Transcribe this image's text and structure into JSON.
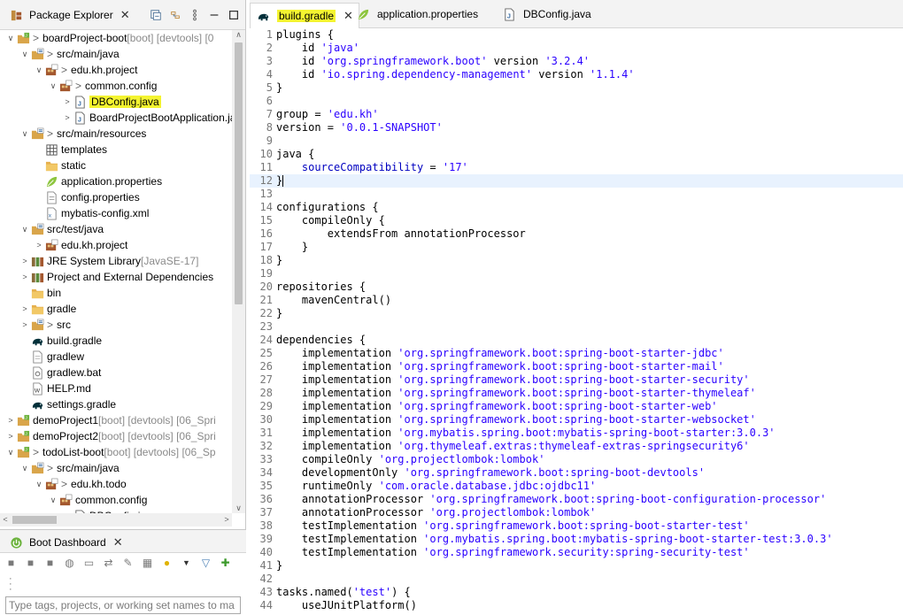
{
  "explorer": {
    "tab_label": "Package Explorer",
    "rows": [
      {
        "tw": "∨",
        "icon": "project-icon",
        "gt": ">",
        "label": "boardProject-boot",
        "dec": " [boot] [devtools] [0",
        "hl": false
      },
      {
        "tw": "∨",
        "icon": "source-folder-icon",
        "gt": ">",
        "label": "src/main/java",
        "dec": "",
        "hl": false
      },
      {
        "tw": "∨",
        "icon": "package-icon",
        "gt": ">",
        "label": "edu.kh.project",
        "dec": "",
        "hl": false
      },
      {
        "tw": "∨",
        "icon": "package-icon",
        "gt": ">",
        "label": "common.config",
        "dec": "",
        "hl": false
      },
      {
        "tw": ">",
        "icon": "java-file-icon",
        "gt": "",
        "label": "DBConfig.java",
        "dec": "",
        "hl": true
      },
      {
        "tw": ">",
        "icon": "java-file-icon",
        "gt": "",
        "label": "BoardProjectBootApplication.jav",
        "dec": "",
        "hl": false
      },
      {
        "tw": "∨",
        "icon": "source-folder-icon",
        "gt": ">",
        "label": "src/main/resources",
        "dec": "",
        "hl": false
      },
      {
        "tw": "",
        "icon": "grid-folder-icon",
        "gt": "",
        "label": "templates",
        "dec": "",
        "hl": false
      },
      {
        "tw": "",
        "icon": "folder-icon",
        "gt": "",
        "label": "static",
        "dec": "",
        "hl": false
      },
      {
        "tw": "",
        "icon": "spring-leaf-icon",
        "gt": "",
        "label": "application.properties",
        "dec": "",
        "hl": false
      },
      {
        "tw": "",
        "icon": "properties-file-icon",
        "gt": "",
        "label": "config.properties",
        "dec": "",
        "hl": false
      },
      {
        "tw": "",
        "icon": "xml-file-icon",
        "gt": "",
        "label": "mybatis-config.xml",
        "dec": "",
        "hl": false
      },
      {
        "tw": "∨",
        "icon": "source-folder-icon",
        "gt": "",
        "label": "src/test/java",
        "dec": "",
        "hl": false
      },
      {
        "tw": ">",
        "icon": "package-icon",
        "gt": "",
        "label": "edu.kh.project",
        "dec": "",
        "hl": false
      },
      {
        "tw": ">",
        "icon": "library-icon",
        "gt": "",
        "label": "JRE System Library",
        "dec": " [JavaSE-17]",
        "hl": false
      },
      {
        "tw": ">",
        "icon": "library-icon",
        "gt": "",
        "label": "Project and External Dependencies",
        "dec": "",
        "hl": false
      },
      {
        "tw": "",
        "icon": "folder-icon",
        "gt": "",
        "label": "bin",
        "dec": "",
        "hl": false
      },
      {
        "tw": ">",
        "icon": "folder-icon",
        "gt": "",
        "label": "gradle",
        "dec": "",
        "hl": false
      },
      {
        "tw": ">",
        "icon": "source-folder-icon",
        "gt": ">",
        "label": "src",
        "dec": "",
        "hl": false
      },
      {
        "tw": "",
        "icon": "gradle-elephant-icon",
        "gt": "",
        "label": "build.gradle",
        "dec": "",
        "hl": false
      },
      {
        "tw": "",
        "icon": "text-file-icon",
        "gt": "",
        "label": "gradlew",
        "dec": "",
        "hl": false
      },
      {
        "tw": "",
        "icon": "bat-file-icon",
        "gt": "",
        "label": "gradlew.bat",
        "dec": "",
        "hl": false
      },
      {
        "tw": "",
        "icon": "markdown-file-icon",
        "gt": "",
        "label": "HELP.md",
        "dec": "",
        "hl": false
      },
      {
        "tw": "",
        "icon": "gradle-elephant-icon",
        "gt": "",
        "label": "settings.gradle",
        "dec": "",
        "hl": false
      },
      {
        "tw": ">",
        "icon": "project-icon",
        "gt": "",
        "label": "demoProject1",
        "dec": " [boot] [devtools] [06_Spri",
        "hl": false
      },
      {
        "tw": ">",
        "icon": "project-icon",
        "gt": "",
        "label": "demoProject2",
        "dec": " [boot] [devtools] [06_Spri",
        "hl": false
      },
      {
        "tw": "∨",
        "icon": "project-icon",
        "gt": ">",
        "label": "todoList-boot",
        "dec": " [boot] [devtools] [06_Sp",
        "hl": false
      },
      {
        "tw": "∨",
        "icon": "source-folder-icon",
        "gt": ">",
        "label": "src/main/java",
        "dec": "",
        "hl": false
      },
      {
        "tw": "∨",
        "icon": "package-icon",
        "gt": ">",
        "label": "edu.kh.todo",
        "dec": "",
        "hl": false
      },
      {
        "tw": "∨",
        "icon": "package-icon",
        "gt": "",
        "label": "common.config",
        "dec": "",
        "hl": false
      },
      {
        "tw": "",
        "icon": "java-file-icon",
        "gt": "",
        "label": "DBConfig.java",
        "dec": "",
        "hl": false
      }
    ]
  },
  "boot_dashboard": {
    "tab_label": "Boot Dashboard",
    "filter_placeholder": "Type tags, projects, or working set names to ma"
  },
  "editor": {
    "tabs": [
      {
        "label": "build.gradle",
        "active": true,
        "icon": "gradle-elephant-icon"
      },
      {
        "label": "application.properties",
        "active": false,
        "icon": "spring-leaf-icon"
      },
      {
        "label": "DBConfig.java",
        "active": false,
        "icon": "java-file-icon"
      }
    ],
    "current_line": 12,
    "lines": [
      {
        "n": "1",
        "segs": [
          [
            "t",
            "plugins {"
          ]
        ]
      },
      {
        "n": "2",
        "segs": [
          [
            "t",
            "    id "
          ],
          [
            "s",
            "'java'"
          ]
        ]
      },
      {
        "n": "3",
        "segs": [
          [
            "t",
            "    id "
          ],
          [
            "s",
            "'org.springframework.boot'"
          ],
          [
            "t",
            " version "
          ],
          [
            "s",
            "'3.2.4'"
          ]
        ]
      },
      {
        "n": "4",
        "segs": [
          [
            "t",
            "    id "
          ],
          [
            "s",
            "'io.spring.dependency-management'"
          ],
          [
            "t",
            " version "
          ],
          [
            "s",
            "'1.1.4'"
          ]
        ]
      },
      {
        "n": "5",
        "segs": [
          [
            "t",
            "}"
          ]
        ]
      },
      {
        "n": "6",
        "segs": []
      },
      {
        "n": "7",
        "segs": [
          [
            "t",
            "group = "
          ],
          [
            "s",
            "'edu.kh'"
          ]
        ]
      },
      {
        "n": "8",
        "segs": [
          [
            "t",
            "version = "
          ],
          [
            "s",
            "'0.0.1-SNAPSHOT'"
          ]
        ]
      },
      {
        "n": "9",
        "segs": []
      },
      {
        "n": "10",
        "segs": [
          [
            "t",
            "java {"
          ]
        ]
      },
      {
        "n": "11",
        "segs": [
          [
            "t",
            "    "
          ],
          [
            "f",
            "sourceCompatibility"
          ],
          [
            "t",
            " = "
          ],
          [
            "s",
            "'17'"
          ]
        ]
      },
      {
        "n": "12",
        "segs": [
          [
            "t",
            "}"
          ]
        ]
      },
      {
        "n": "13",
        "segs": []
      },
      {
        "n": "14",
        "segs": [
          [
            "t",
            "configurations {"
          ]
        ]
      },
      {
        "n": "15",
        "segs": [
          [
            "t",
            "    compileOnly {"
          ]
        ]
      },
      {
        "n": "16",
        "segs": [
          [
            "t",
            "        extendsFrom annotationProcessor"
          ]
        ]
      },
      {
        "n": "17",
        "segs": [
          [
            "t",
            "    }"
          ]
        ]
      },
      {
        "n": "18",
        "segs": [
          [
            "t",
            "}"
          ]
        ]
      },
      {
        "n": "19",
        "segs": []
      },
      {
        "n": "20",
        "segs": [
          [
            "t",
            "repositories {"
          ]
        ]
      },
      {
        "n": "21",
        "segs": [
          [
            "t",
            "    mavenCentral()"
          ]
        ]
      },
      {
        "n": "22",
        "segs": [
          [
            "t",
            "}"
          ]
        ]
      },
      {
        "n": "23",
        "segs": []
      },
      {
        "n": "24",
        "segs": [
          [
            "t",
            "dependencies {"
          ]
        ]
      },
      {
        "n": "25",
        "segs": [
          [
            "t",
            "    implementation "
          ],
          [
            "s",
            "'org.springframework.boot:spring-boot-starter-jdbc'"
          ]
        ]
      },
      {
        "n": "26",
        "segs": [
          [
            "t",
            "    implementation "
          ],
          [
            "s",
            "'org.springframework.boot:spring-boot-starter-mail'"
          ]
        ]
      },
      {
        "n": "27",
        "segs": [
          [
            "t",
            "    implementation "
          ],
          [
            "s",
            "'org.springframework.boot:spring-boot-starter-security'"
          ]
        ]
      },
      {
        "n": "28",
        "segs": [
          [
            "t",
            "    implementation "
          ],
          [
            "s",
            "'org.springframework.boot:spring-boot-starter-thymeleaf'"
          ]
        ]
      },
      {
        "n": "29",
        "segs": [
          [
            "t",
            "    implementation "
          ],
          [
            "s",
            "'org.springframework.boot:spring-boot-starter-web'"
          ]
        ]
      },
      {
        "n": "30",
        "segs": [
          [
            "t",
            "    implementation "
          ],
          [
            "s",
            "'org.springframework.boot:spring-boot-starter-websocket'"
          ]
        ]
      },
      {
        "n": "31",
        "segs": [
          [
            "t",
            "    implementation "
          ],
          [
            "s",
            "'org.mybatis.spring.boot:mybatis-spring-boot-starter:3.0.3'"
          ]
        ]
      },
      {
        "n": "32",
        "segs": [
          [
            "t",
            "    implementation "
          ],
          [
            "s",
            "'org.thymeleaf.extras:thymeleaf-extras-springsecurity6'"
          ]
        ]
      },
      {
        "n": "33",
        "segs": [
          [
            "t",
            "    compileOnly "
          ],
          [
            "s",
            "'org.projectlombok:lombok'"
          ]
        ]
      },
      {
        "n": "34",
        "segs": [
          [
            "t",
            "    developmentOnly "
          ],
          [
            "s",
            "'org.springframework.boot:spring-boot-devtools'"
          ]
        ]
      },
      {
        "n": "35",
        "segs": [
          [
            "t",
            "    runtimeOnly "
          ],
          [
            "s",
            "'com.oracle.database.jdbc:ojdbc11'"
          ]
        ]
      },
      {
        "n": "36",
        "segs": [
          [
            "t",
            "    annotationProcessor "
          ],
          [
            "s",
            "'org.springframework.boot:spring-boot-configuration-processor'"
          ]
        ]
      },
      {
        "n": "37",
        "segs": [
          [
            "t",
            "    annotationProcessor "
          ],
          [
            "s",
            "'org.projectlombok:lombok'"
          ]
        ]
      },
      {
        "n": "38",
        "segs": [
          [
            "t",
            "    testImplementation "
          ],
          [
            "s",
            "'org.springframework.boot:spring-boot-starter-test'"
          ]
        ]
      },
      {
        "n": "39",
        "segs": [
          [
            "t",
            "    testImplementation "
          ],
          [
            "s",
            "'org.mybatis.spring.boot:mybatis-spring-boot-starter-test:3.0.3'"
          ]
        ]
      },
      {
        "n": "40",
        "segs": [
          [
            "t",
            "    testImplementation "
          ],
          [
            "s",
            "'org.springframework.security:spring-security-test'"
          ]
        ]
      },
      {
        "n": "41",
        "segs": [
          [
            "t",
            "}"
          ]
        ]
      },
      {
        "n": "42",
        "segs": []
      },
      {
        "n": "43",
        "segs": [
          [
            "t",
            "tasks.named("
          ],
          [
            "s",
            "'test'"
          ],
          [
            "t",
            ") {"
          ]
        ]
      },
      {
        "n": "44",
        "segs": [
          [
            "t",
            "    useJUnitPlatform()"
          ]
        ]
      }
    ]
  },
  "colors": {
    "string": "#2a00ff",
    "field": "#0000c0",
    "line_number": "#787878",
    "current_line_bg": "#e8f2fe",
    "highlight": "#f4f430"
  }
}
